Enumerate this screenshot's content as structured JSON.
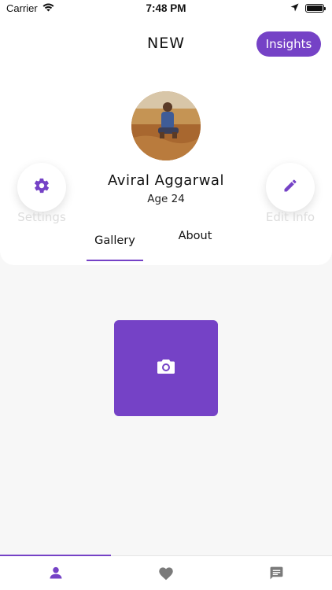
{
  "status_bar": {
    "carrier": "Carrier",
    "time": "7:48 PM"
  },
  "header": {
    "title": "NEW",
    "insights_label": "Insights"
  },
  "profile": {
    "name": "Aviral Aggarwal",
    "age": "Age 24",
    "settings_label": "Settings",
    "edit_label": "Edit Info"
  },
  "tabs": [
    {
      "label": "Gallery",
      "active": true
    },
    {
      "label": "About",
      "active": false
    }
  ],
  "gallery": {
    "add_photo_icon": "camera-icon"
  },
  "bottom_nav": [
    {
      "icon": "person-icon",
      "active": true
    },
    {
      "icon": "heart-icon",
      "active": false
    },
    {
      "icon": "chat-icon",
      "active": false
    }
  ],
  "colors": {
    "accent": "#7542c6",
    "nav_inactive": "#7a7a7a",
    "label_faded": "#dcdcdc"
  }
}
